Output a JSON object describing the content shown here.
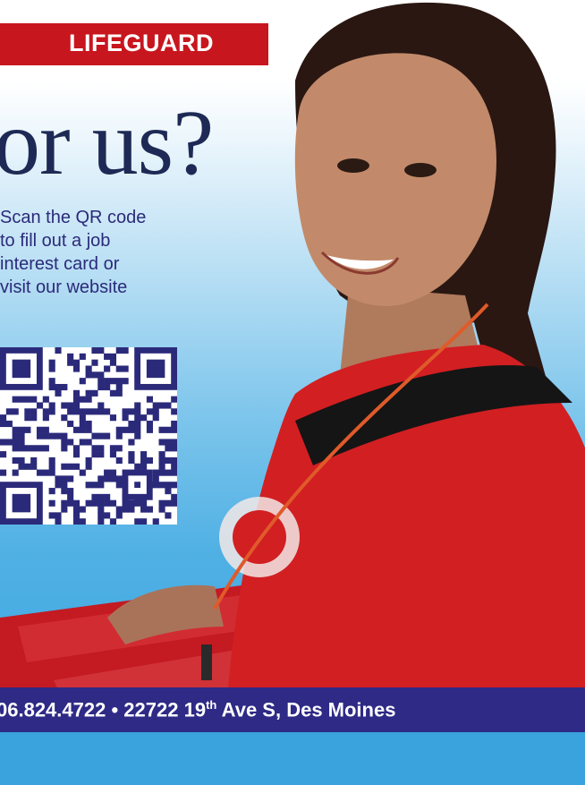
{
  "banner": {
    "label": "LIFEGUARD",
    "color": "#c8161e"
  },
  "headline": {
    "text": "or us?"
  },
  "qr_prompt": {
    "lines": [
      "Scan the QR code",
      "to fill out a job",
      "interest card or",
      "visit our website"
    ]
  },
  "qr_code": {
    "kind": "qr-code"
  },
  "photo": {
    "subject": "lifeguard-photo"
  },
  "footer": {
    "phone": "06.824.4722",
    "separator": "•",
    "address_number": "22722 19",
    "address_suffix": "th",
    "address_rest": "Ave S, Des Moines",
    "color": "#2e2a86"
  },
  "colors": {
    "text_navy": "#1e2a55",
    "text_purple": "#2b2a7a",
    "sky_blue": "#3aa4df"
  }
}
